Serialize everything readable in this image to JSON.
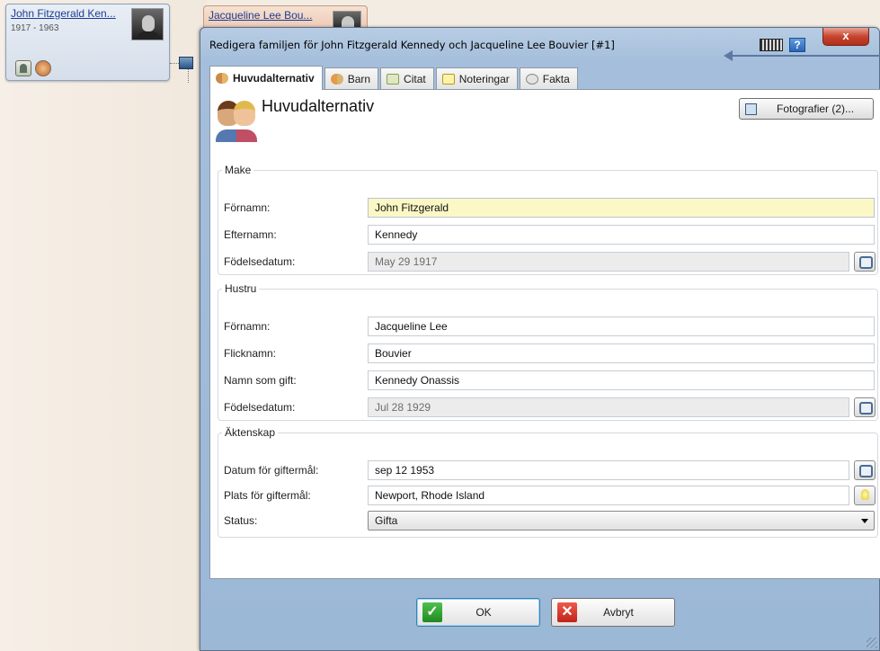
{
  "tree": {
    "husband": {
      "name": "John Fitzgerald Ken...",
      "dates": "1917 - 1963",
      "portrait_icon": "portrait-photo"
    },
    "wife": {
      "name": "Jacqueline Lee Bou...",
      "portrait_icon": "portrait-photo"
    }
  },
  "dialog": {
    "title": "Redigera familjen för John Fitzgerald Kennedy och Jacqueline Lee Bouvier [#1]",
    "help_label": "?",
    "close_label": "x",
    "tabs": [
      {
        "label": "Huvudalternativ",
        "icon": "people-icon",
        "active": true
      },
      {
        "label": "Barn",
        "icon": "children-icon",
        "active": false
      },
      {
        "label": "Citat",
        "icon": "quote-icon",
        "active": false
      },
      {
        "label": "Noteringar",
        "icon": "notes-icon",
        "active": false
      },
      {
        "label": "Fakta",
        "icon": "facts-icon",
        "active": false
      }
    ],
    "section_title": "Huvudalternativ",
    "photos_button": "Fotografier (2)...",
    "make": {
      "legend": "Make",
      "first_name_label": "Förnamn:",
      "first_name": "John Fitzgerald",
      "last_name_label": "Efternamn:",
      "last_name": "Kennedy",
      "birth_label": "Födelsedatum:",
      "birth": "May 29 1917"
    },
    "hustru": {
      "legend": "Hustru",
      "first_name_label": "Förnamn:",
      "first_name": "Jacqueline Lee",
      "maiden_label": "Flicknamn:",
      "maiden": "Bouvier",
      "married_label": "Namn som gift:",
      "married": "Kennedy Onassis",
      "birth_label": "Födelsedatum:",
      "birth": "Jul 28 1929"
    },
    "marriage": {
      "legend": "Äktenskap",
      "date_label": "Datum för giftermål:",
      "date": "sep 12 1953",
      "place_label": "Plats för giftermål:",
      "place": "Newport, Rhode Island",
      "status_label": "Status:",
      "status": "Gifta"
    },
    "ok_label": "OK",
    "cancel_label": "Avbryt"
  }
}
